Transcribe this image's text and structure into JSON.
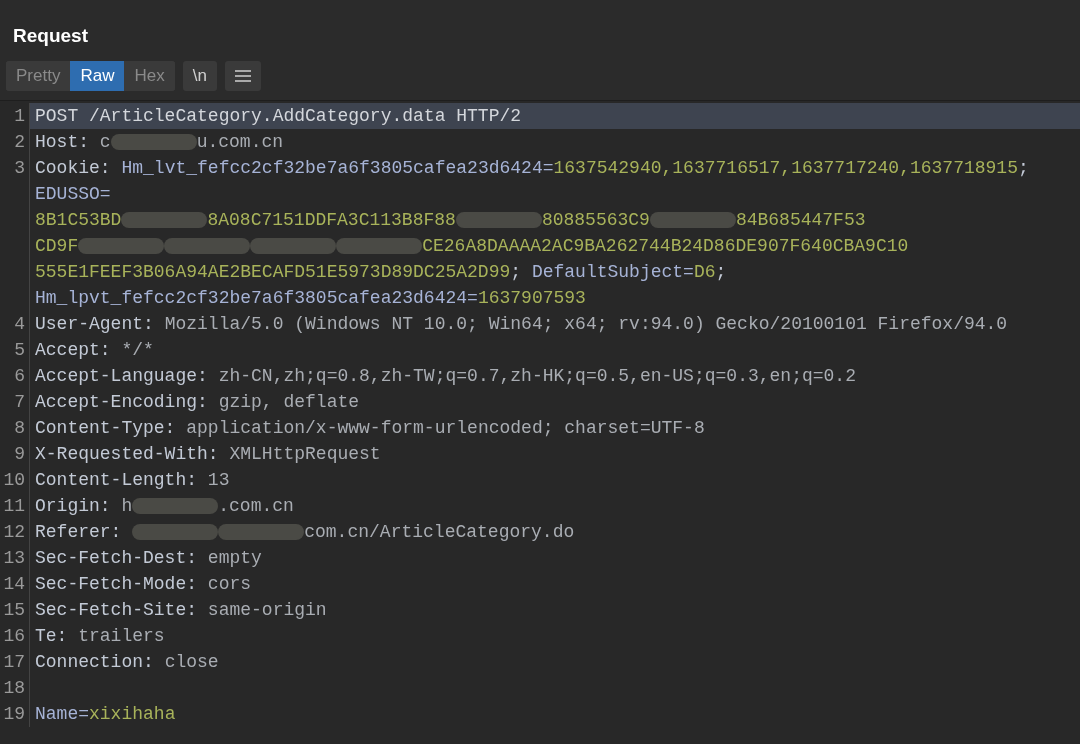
{
  "panel": {
    "title": "Request"
  },
  "tabs": [
    {
      "label": "Pretty",
      "selected": false
    },
    {
      "label": "Raw",
      "selected": true
    },
    {
      "label": "Hex",
      "selected": false
    }
  ],
  "toolbar": {
    "newline_button": "\\n"
  },
  "editor": {
    "lines": [
      {
        "number": "1",
        "highlighted": true,
        "wraps": [
          {
            "parts": [
              {
                "kind": "plain",
                "text": "POST /ArticleCategory.AddCategory.data HTTP/2"
              }
            ]
          }
        ]
      },
      {
        "number": "2",
        "highlighted": false,
        "wraps": [
          {
            "parts": [
              {
                "kind": "key",
                "text": "Host: "
              },
              {
                "kind": "value",
                "text": "c"
              },
              {
                "kind": "redacted"
              },
              {
                "kind": "value",
                "text": "u.com.cn"
              }
            ]
          }
        ]
      },
      {
        "number": "3",
        "highlighted": false,
        "wraps": [
          {
            "parts": [
              {
                "kind": "key",
                "text": "Cookie: "
              },
              {
                "kind": "name",
                "text": "Hm_lvt_fefcc2cf32be7a6f3805cafea23d6424="
              },
              {
                "kind": "cval",
                "text": "1637542940,1637716517,1637717240,1637718915"
              },
              {
                "kind": "key",
                "text": ";"
              }
            ]
          },
          {
            "parts": [
              {
                "kind": "name",
                "text": "EDUSSO="
              }
            ]
          },
          {
            "parts": [
              {
                "kind": "cval",
                "text": "8B1C53BD"
              },
              {
                "kind": "redacted"
              },
              {
                "kind": "cval",
                "text": "8A08C7151DDFA3C113B8F88"
              },
              {
                "kind": "redacted"
              },
              {
                "kind": "cval",
                "text": "80885563C9"
              },
              {
                "kind": "redacted"
              },
              {
                "kind": "cval",
                "text": "84B685447F53"
              }
            ]
          },
          {
            "parts": [
              {
                "kind": "cval",
                "text": "CD9F"
              },
              {
                "kind": "redacted"
              },
              {
                "kind": "redacted"
              },
              {
                "kind": "redacted"
              },
              {
                "kind": "redacted"
              },
              {
                "kind": "cval",
                "text": "CE26A8DAAAA2AC9BA262744B24D86DE907F640CBA9C10"
              }
            ]
          },
          {
            "parts": [
              {
                "kind": "cval",
                "text": "555E1FEEF3B06A94AE2BECAFD51E5973D89DC25A2D99"
              },
              {
                "kind": "key",
                "text": "; "
              },
              {
                "kind": "name",
                "text": "DefaultSubject="
              },
              {
                "kind": "cval",
                "text": "D6"
              },
              {
                "kind": "key",
                "text": ";"
              }
            ]
          },
          {
            "parts": [
              {
                "kind": "name",
                "text": "Hm_lpvt_fefcc2cf32be7a6f3805cafea23d6424="
              },
              {
                "kind": "cval",
                "text": "1637907593"
              }
            ]
          }
        ]
      },
      {
        "number": "4",
        "highlighted": false,
        "wraps": [
          {
            "parts": [
              {
                "kind": "key",
                "text": "User-Agent: "
              },
              {
                "kind": "value",
                "text": "Mozilla/5.0 (Windows NT 10.0; Win64; x64; rv:94.0) Gecko/20100101 Firefox/94.0"
              }
            ]
          }
        ]
      },
      {
        "number": "5",
        "highlighted": false,
        "wraps": [
          {
            "parts": [
              {
                "kind": "key",
                "text": "Accept: "
              },
              {
                "kind": "value",
                "text": "*/*"
              }
            ]
          }
        ]
      },
      {
        "number": "6",
        "highlighted": false,
        "wraps": [
          {
            "parts": [
              {
                "kind": "key",
                "text": "Accept-Language: "
              },
              {
                "kind": "value",
                "text": "zh-CN,zh;q=0.8,zh-TW;q=0.7,zh-HK;q=0.5,en-US;q=0.3,en;q=0.2"
              }
            ]
          }
        ]
      },
      {
        "number": "7",
        "highlighted": false,
        "wraps": [
          {
            "parts": [
              {
                "kind": "key",
                "text": "Accept-Encoding: "
              },
              {
                "kind": "value",
                "text": "gzip, deflate"
              }
            ]
          }
        ]
      },
      {
        "number": "8",
        "highlighted": false,
        "wraps": [
          {
            "parts": [
              {
                "kind": "key",
                "text": "Content-Type: "
              },
              {
                "kind": "value",
                "text": "application/x-www-form-urlencoded; charset=UTF-8"
              }
            ]
          }
        ]
      },
      {
        "number": "9",
        "highlighted": false,
        "wraps": [
          {
            "parts": [
              {
                "kind": "key",
                "text": "X-Requested-With: "
              },
              {
                "kind": "value",
                "text": "XMLHttpRequest"
              }
            ]
          }
        ]
      },
      {
        "number": "10",
        "highlighted": false,
        "wraps": [
          {
            "parts": [
              {
                "kind": "key",
                "text": "Content-Length: "
              },
              {
                "kind": "value",
                "text": "13"
              }
            ]
          }
        ]
      },
      {
        "number": "11",
        "highlighted": false,
        "wraps": [
          {
            "parts": [
              {
                "kind": "key",
                "text": "Origin: "
              },
              {
                "kind": "value",
                "text": "h"
              },
              {
                "kind": "redacted"
              },
              {
                "kind": "value",
                "text": ".com.cn"
              }
            ]
          }
        ]
      },
      {
        "number": "12",
        "highlighted": false,
        "wraps": [
          {
            "parts": [
              {
                "kind": "key",
                "text": "Referer: "
              },
              {
                "kind": "redacted"
              },
              {
                "kind": "redacted"
              },
              {
                "kind": "value",
                "text": "com.cn/ArticleCategory.do"
              }
            ]
          }
        ]
      },
      {
        "number": "13",
        "highlighted": false,
        "wraps": [
          {
            "parts": [
              {
                "kind": "key",
                "text": "Sec-Fetch-Dest: "
              },
              {
                "kind": "value",
                "text": "empty"
              }
            ]
          }
        ]
      },
      {
        "number": "14",
        "highlighted": false,
        "wraps": [
          {
            "parts": [
              {
                "kind": "key",
                "text": "Sec-Fetch-Mode: "
              },
              {
                "kind": "value",
                "text": "cors"
              }
            ]
          }
        ]
      },
      {
        "number": "15",
        "highlighted": false,
        "wraps": [
          {
            "parts": [
              {
                "kind": "key",
                "text": "Sec-Fetch-Site: "
              },
              {
                "kind": "value",
                "text": "same-origin"
              }
            ]
          }
        ]
      },
      {
        "number": "16",
        "highlighted": false,
        "wraps": [
          {
            "parts": [
              {
                "kind": "key",
                "text": "Te: "
              },
              {
                "kind": "value",
                "text": "trailers"
              }
            ]
          }
        ]
      },
      {
        "number": "17",
        "highlighted": false,
        "wraps": [
          {
            "parts": [
              {
                "kind": "key",
                "text": "Connection: "
              },
              {
                "kind": "value",
                "text": "close"
              }
            ]
          }
        ]
      },
      {
        "number": "18",
        "highlighted": false,
        "blank": true
      },
      {
        "number": "19",
        "highlighted": false,
        "wraps": [
          {
            "parts": [
              {
                "kind": "name",
                "text": "Name="
              },
              {
                "kind": "cval",
                "text": "xixihaha"
              }
            ]
          }
        ]
      }
    ]
  }
}
